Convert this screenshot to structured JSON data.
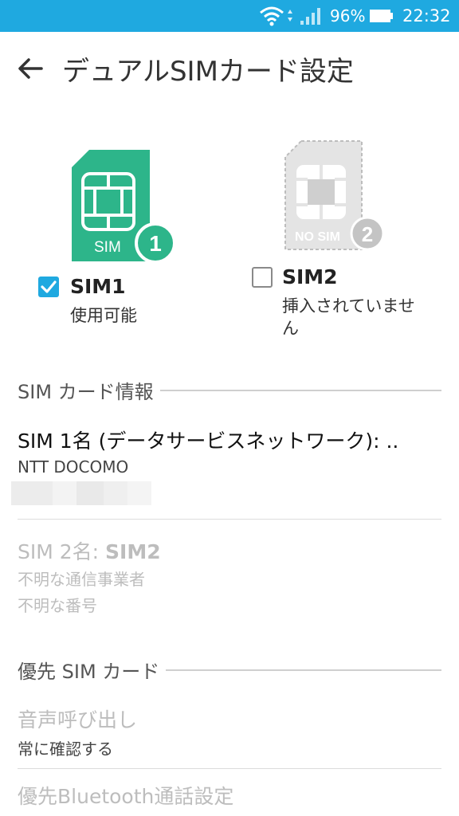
{
  "status_bar": {
    "battery_pct": "96%",
    "time": "22:32"
  },
  "header": {
    "title": "デュアルSIMカード設定"
  },
  "sims": {
    "sim1": {
      "card_text": "SIM",
      "badge": "1",
      "name": "SIM1",
      "status": "使用可能",
      "checked": true
    },
    "sim2": {
      "card_text": "NO SIM",
      "badge": "2",
      "name": "SIM2",
      "status_line1": "挿入されていませ",
      "status_line2": "ん",
      "checked": false
    }
  },
  "sim_info": {
    "section_label": "SIM カード情報",
    "sim1_title": "SIM 1名 (データサービスネットワーク): ..",
    "sim1_carrier": "NTT DOCOMO",
    "sim2_title_prefix": "SIM 2名: ",
    "sim2_title_name": "SIM2",
    "sim2_carrier": "不明な通信事業者",
    "sim2_number": "不明な番号"
  },
  "preferred": {
    "section_label": "優先 SIM カード",
    "voice_title": "音声呼び出し",
    "voice_value": "常に確認する",
    "bt_title": "優先Bluetooth通話設定"
  },
  "colors": {
    "accent": "#1fa9e0",
    "sim_green": "#2db58a",
    "disabled": "#bdbdbd"
  }
}
